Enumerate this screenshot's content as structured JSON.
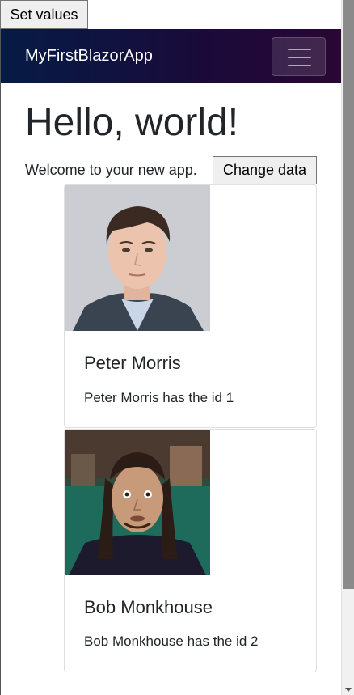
{
  "toolbar": {
    "set_values_label": "Set values"
  },
  "navbar": {
    "brand": "MyFirstBlazorApp"
  },
  "main": {
    "title": "Hello, world!",
    "welcome": "Welcome to your new app.",
    "change_data_label": "Change data"
  },
  "people": [
    {
      "name": "Peter Morris",
      "description": "Peter Morris has the id 1"
    },
    {
      "name": "Bob Monkhouse",
      "description": "Bob Monkhouse has the id 2"
    }
  ],
  "colors": {
    "navbar_start": "#061b45",
    "navbar_end": "#2a0734",
    "text": "#212529"
  }
}
